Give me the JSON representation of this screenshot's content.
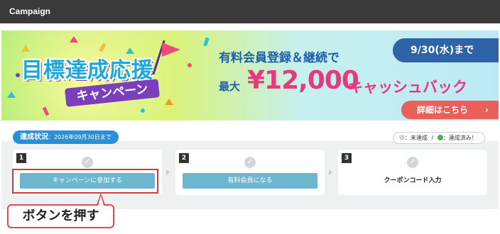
{
  "header": {
    "title": "Campaign"
  },
  "banner": {
    "logo_main": "目標達成応援",
    "logo_sub": "キャンペーン",
    "line1": "有料会員登録＆継続で",
    "line2_pre": "最大",
    "amount": "¥12,000",
    "line2_post": "キャッシュバック",
    "deadline": "9/30(水)まで",
    "details_button": "詳細はこちら",
    "details_chevron": "›"
  },
  "status": {
    "label": "達成状況",
    "date": "：2026年09月30日まで",
    "legend_incomplete": "：未達成",
    "legend_separator": "/",
    "legend_complete": "：達成済み！",
    "colors": {
      "incomplete": "#d3d6d9",
      "complete": "#4caf50"
    }
  },
  "steps": [
    {
      "number": "1",
      "action": "キャンペーンに参加する",
      "check": "✓"
    },
    {
      "number": "2",
      "action": "有料会員になる",
      "check": "✓"
    },
    {
      "number": "3",
      "action": "クーポンコード入力",
      "check": "✓"
    }
  ],
  "callout": {
    "text": "ボタンを押す"
  }
}
